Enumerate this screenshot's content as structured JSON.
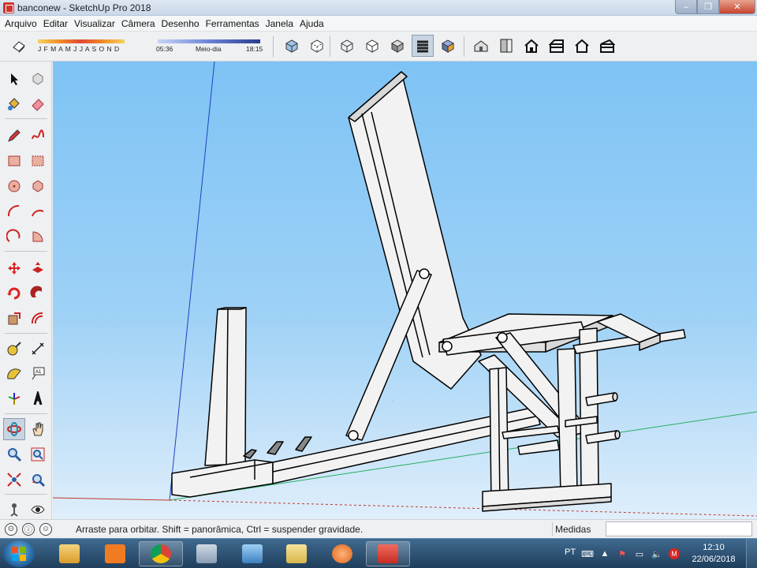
{
  "window": {
    "title": "banconew - SketchUp Pro 2018",
    "controls": {
      "minimize": "–",
      "maximize": "❐",
      "close": "✕"
    }
  },
  "menu": [
    "Arquivo",
    "Editar",
    "Visualizar",
    "Câmera",
    "Desenho",
    "Ferramentas",
    "Janela",
    "Ajuda"
  ],
  "toolbar": {
    "shadow_months": "J F M A M J J A S O N D",
    "time_start": "05:36",
    "time_mid": "Meio-dia",
    "time_end": "18:15",
    "style_buttons": [
      "xray-icon",
      "back-edges-icon",
      "wireframe-icon",
      "hidden-line-icon",
      "shaded-icon",
      "shaded-textures-icon",
      "monochrome-icon"
    ],
    "view_buttons": [
      "iso-view-icon",
      "top-view-icon",
      "front-view-icon",
      "right-view-icon",
      "back-view-icon",
      "left-view-icon"
    ],
    "active_style": "shaded-textures-icon"
  },
  "tools": [
    "select-icon",
    "component-icon",
    "paint-bucket-icon",
    "eraser-icon",
    "pencil-icon",
    "freehand-icon",
    "rectangle-icon",
    "rotated-rectangle-icon",
    "circle-icon",
    "polygon-icon",
    "arc-icon",
    "two-point-arc-icon",
    "three-point-arc-icon",
    "pie-icon",
    "move-icon",
    "push-pull-icon",
    "rotate-icon",
    "follow-me-icon",
    "scale-icon",
    "offset-icon",
    "tape-measure-icon",
    "dimension-icon",
    "protractor-icon",
    "text-icon",
    "axes-icon",
    "3d-text-icon",
    "orbit-icon",
    "pan-icon",
    "zoom-icon",
    "zoom-window-icon",
    "zoom-extents-icon",
    "previous-view-icon",
    "position-camera-icon",
    "look-around-icon"
  ],
  "active_tool": "orbit-icon",
  "status": {
    "message": "Arraste para orbitar. Shift = panorâmica, Ctrl = suspender gravidade.",
    "measurements_label": "Medidas",
    "measurements_value": ""
  },
  "taskbar": {
    "language": "PT",
    "time": "12:10",
    "date": "22/06/2018",
    "apps": [
      "windows-explorer-icon",
      "media-player-icon",
      "chrome-icon",
      "calculator-icon",
      "network-computer-icon",
      "folder-icon",
      "avast-icon",
      "sketchup-icon"
    ]
  },
  "colors": {
    "sky_top": "#7ec3f5",
    "sky_bottom": "#dfeefb",
    "model_face": "#f2f2f2",
    "model_edge": "#000000",
    "axis_red": "#c0392b",
    "axis_green": "#27ae60",
    "axis_blue": "#2040c0"
  }
}
